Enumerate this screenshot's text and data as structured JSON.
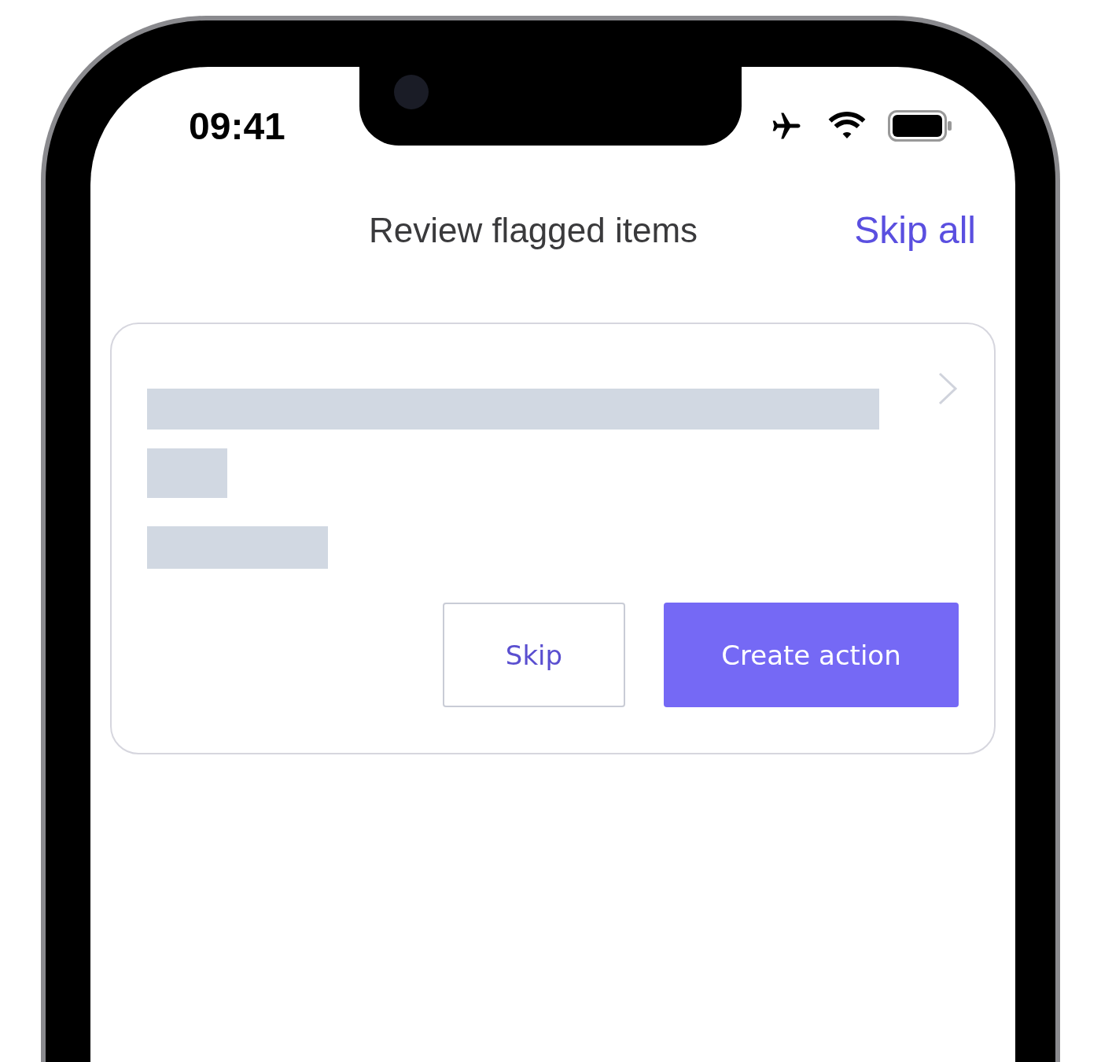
{
  "status_bar": {
    "time": "09:41"
  },
  "header": {
    "title": "Review flagged items",
    "skip_all": "Skip all"
  },
  "card": {
    "buttons": [
      {
        "kind": "secondary",
        "label": "Skip"
      },
      {
        "kind": "primary",
        "label": "Create action"
      }
    ]
  }
}
